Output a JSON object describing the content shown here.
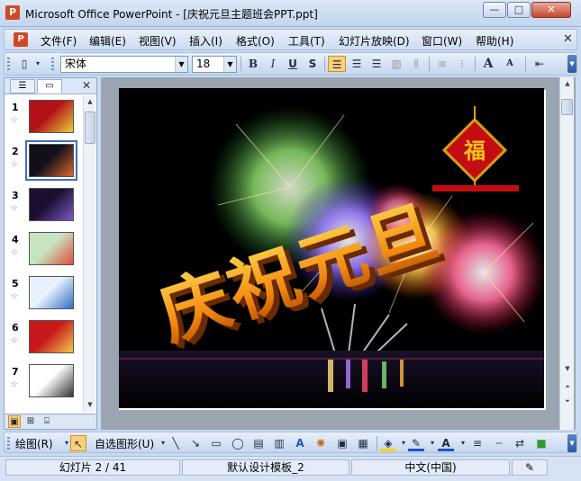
{
  "window": {
    "title": "Microsoft Office PowerPoint - [庆祝元旦主题班会PPT.ppt]",
    "minimize": "—",
    "maximize": "□",
    "close": "✕"
  },
  "menubar": {
    "items": [
      "文件(F)",
      "编辑(E)",
      "视图(V)",
      "插入(I)",
      "格式(O)",
      "工具(T)",
      "幻灯片放映(D)",
      "窗口(W)",
      "帮助(H)"
    ],
    "close": "✕"
  },
  "toolbar": {
    "font_name": "宋体",
    "font_size": "18",
    "bold": "B",
    "italic": "I",
    "underline": "U",
    "shadow": "S",
    "font_grow": "A",
    "font_shrink": "A"
  },
  "slides_pane": {
    "close": "✕",
    "thumbnails": [
      {
        "num": "1",
        "colors": [
          "#b31217",
          "#e8d13c"
        ]
      },
      {
        "num": "2",
        "colors": [
          "#120f1a",
          "#d9662b"
        ],
        "selected": true
      },
      {
        "num": "3",
        "colors": [
          "#1c1030",
          "#7b5ac7"
        ]
      },
      {
        "num": "4",
        "colors": [
          "#c6e4c0",
          "#e14b3b"
        ]
      },
      {
        "num": "5",
        "colors": [
          "#e8f2ff",
          "#2e6fc0"
        ]
      },
      {
        "num": "6",
        "colors": [
          "#c7181b",
          "#f2c94c"
        ]
      },
      {
        "num": "7",
        "colors": [
          "#ffffff",
          "#333333"
        ]
      }
    ]
  },
  "slide": {
    "title_text": "庆祝元旦",
    "knot_char": "福"
  },
  "drawing_toolbar": {
    "draw_label": "绘图(R)",
    "autoshapes_label": "自选图形(U)"
  },
  "statusbar": {
    "slide_info": "幻灯片 2 / 41",
    "template": "默认设计模板_2",
    "language": "中文(中国)"
  }
}
